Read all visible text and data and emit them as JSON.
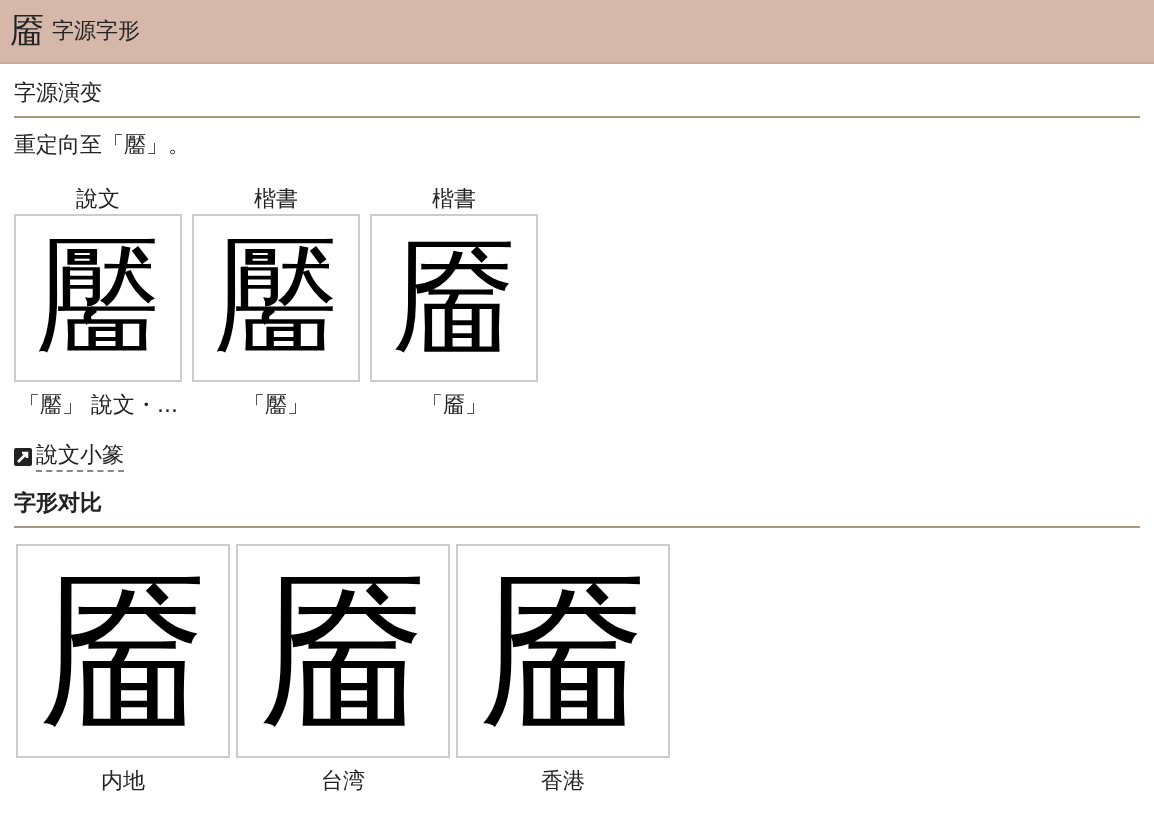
{
  "header": {
    "icon_char": "靥",
    "title": "字源字形"
  },
  "evolution": {
    "heading": "字源演变",
    "redirect": "重定向至「靨」。",
    "items": [
      {
        "label": "說文",
        "glyph": "靨",
        "caption": "「靨」 說文・..."
      },
      {
        "label": "楷書",
        "glyph": "靨",
        "caption": "「靨」"
      },
      {
        "label": "楷書",
        "glyph": "靥",
        "caption": "「靥」"
      }
    ],
    "link": "說文小篆"
  },
  "comparison": {
    "heading": "字形对比",
    "items": [
      {
        "glyph": "靥",
        "caption": "内地"
      },
      {
        "glyph": "靥",
        "caption": "台湾"
      },
      {
        "glyph": "靥",
        "caption": "香港"
      }
    ]
  }
}
